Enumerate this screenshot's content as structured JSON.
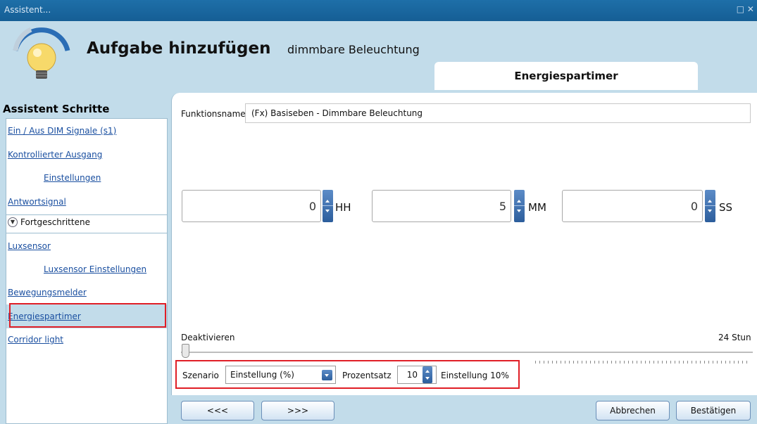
{
  "window": {
    "title": "Assistent...",
    "controls": "□ ✕"
  },
  "header": {
    "title": "Aufgabe hinzufügen",
    "subtitle": "dimmbare Beleuchtung",
    "tab_label": "Energiespartimer"
  },
  "sidebar": {
    "heading": "Assistent Schritte",
    "items": [
      {
        "label": "Ein / Aus DIM Signale (s1)"
      },
      {
        "label": "Kontrollierter Ausgang"
      },
      {
        "label": "Einstellungen"
      },
      {
        "label": "Antwortsignal"
      },
      {
        "label": "Fortgeschrittene"
      },
      {
        "label": "Luxsensor"
      },
      {
        "label": "Luxsensor Einstellungen"
      },
      {
        "label": "Bewegungsmelder"
      },
      {
        "label": "Energiespartimer"
      },
      {
        "label": "Corridor light"
      }
    ]
  },
  "form": {
    "function_name_label": "Funktionsname",
    "function_name_value": "(Fx) Basiseben - Dimmbare Beleuchtung",
    "time": {
      "hours": "0",
      "hours_unit": "HH",
      "minutes": "5",
      "minutes_unit": "MM",
      "seconds": "0",
      "seconds_unit": "SS"
    },
    "slider": {
      "min_label": "Deaktivieren",
      "max_label": "24 Stun",
      "value_fraction": 0
    },
    "scenario_label": "Szenario",
    "scenario_value": "Einstellung (%)",
    "percent_label": "Prozentsatz",
    "percent_value": "10",
    "setting_text": "Einstellung 10%"
  },
  "buttons": {
    "back": "<<<",
    "next": ">>>",
    "cancel": "Abbrechen",
    "confirm": "Bestätigen"
  },
  "colors": {
    "panel_bg": "#c2dcea",
    "title_bar": "#1e6fa8",
    "highlight_border": "#e01e26",
    "link": "#1a4fa0"
  }
}
